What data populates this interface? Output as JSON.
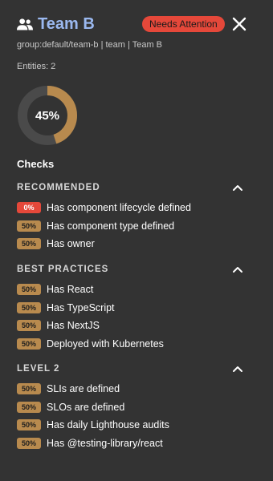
{
  "header": {
    "title": "Team B",
    "badge": "Needs Attention",
    "subtitle": "group:default/team-b | team | Team B",
    "entities": "Entities: 2"
  },
  "score": {
    "percent": 45,
    "label": "45%"
  },
  "checks_title": "Checks",
  "colors": {
    "accent": "#b88a4e",
    "danger": "#e5483a",
    "title": "#9bb9f0",
    "track": "#4a4a4a"
  },
  "sections": [
    {
      "label": "RECOMMENDED",
      "items": [
        {
          "pct": "0%",
          "level": "bad",
          "label": "Has component lifecycle defined"
        },
        {
          "pct": "50%",
          "level": "warn",
          "label": "Has component type defined"
        },
        {
          "pct": "50%",
          "level": "warn",
          "label": "Has owner"
        }
      ]
    },
    {
      "label": "BEST PRACTICES",
      "items": [
        {
          "pct": "50%",
          "level": "warn",
          "label": "Has React"
        },
        {
          "pct": "50%",
          "level": "warn",
          "label": "Has TypeScript"
        },
        {
          "pct": "50%",
          "level": "warn",
          "label": "Has NextJS"
        },
        {
          "pct": "50%",
          "level": "warn",
          "label": "Deployed with Kubernetes"
        }
      ]
    },
    {
      "label": "LEVEL 2",
      "items": [
        {
          "pct": "50%",
          "level": "warn",
          "label": "SLIs are defined"
        },
        {
          "pct": "50%",
          "level": "warn",
          "label": "SLOs are defined"
        },
        {
          "pct": "50%",
          "level": "warn",
          "label": "Has daily Lighthouse audits"
        },
        {
          "pct": "50%",
          "level": "warn",
          "label": "Has @testing-library/react"
        }
      ]
    }
  ]
}
